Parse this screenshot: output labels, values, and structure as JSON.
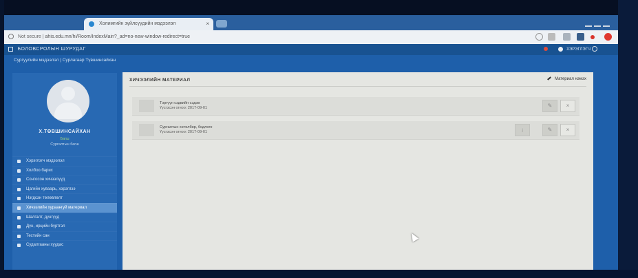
{
  "browser": {
    "tab_title": "Холимгийн зүйлсүүдийн мэдээлэл",
    "tab_close": "×",
    "security_label": "Not secure",
    "url": "ahis.edu.mn/hi/Room/IndexMain?_ad=no-new-window-redirect=true",
    "extensions": [
      "search-icon",
      "star-icon",
      "cast-icon",
      "doc-icon",
      "red-dot-icon",
      "opera-icon"
    ]
  },
  "app": {
    "brand": "БОЛОВСРОЛЫН ШУРУДАГ",
    "nav_user": "ХЭРЭГЛЭГЧ",
    "breadcrumb": "Сургуулийн мэдээлэл | Сурлагаар Түвшинсайхан"
  },
  "profile": {
    "name": "Х.ТӨВШИНСАЙХАН",
    "role": "Багш",
    "subtitle": "Сургалтын багш"
  },
  "menu": {
    "items": [
      {
        "label": "Хэрэглэгч мэдээлэл",
        "icon": "user-icon"
      },
      {
        "label": "Холбоо барих",
        "icon": "phone-icon"
      },
      {
        "label": "Сонгосон хичээлүүд",
        "icon": "book-icon"
      },
      {
        "label": "Цагийн хуваарь, хэрэглээ",
        "icon": "clock-icon"
      },
      {
        "label": "Нэгдсэн төлөвлөлт",
        "icon": "users-icon"
      },
      {
        "label": "Хичээлийн хураангуй материал",
        "icon": "folder-icon"
      },
      {
        "label": "Шалгалт, дүнгүүд",
        "icon": "chart-icon"
      },
      {
        "label": "Дүн, ирцийн бүртгэл",
        "icon": "table-icon"
      },
      {
        "label": "Тестийн сан",
        "icon": "list-icon"
      },
      {
        "label": "Судалгааны хуудас",
        "icon": "arrow-icon"
      }
    ],
    "active_index": 5
  },
  "panel": {
    "title": "ХИЧЭЭЛИЙН МАТЕРИАЛ",
    "action_label": "Материал нэмэх",
    "rows": [
      {
        "title": "Тэргүүн сэдвийн сэдэв",
        "date": "Үүсгэсэн огноо: 2017-09-01"
      },
      {
        "title": "Сургалтын хөтөлбөр, бодлого",
        "date": "Үүсгэсэн огноо: 2017-09-01"
      }
    ]
  },
  "colors": {
    "window_bg": "#1e5faa",
    "sidebar_bg": "#2869b3",
    "active_menu": "#5b93d0",
    "panel_bg": "#e5e6e2",
    "alert": "#e04a3a"
  }
}
